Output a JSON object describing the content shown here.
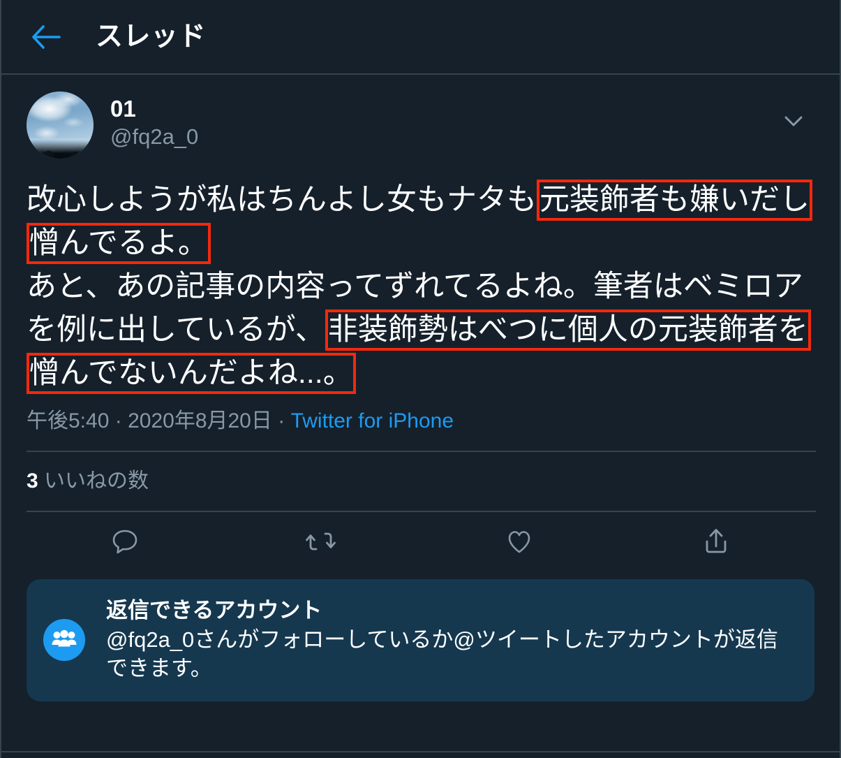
{
  "theme": {
    "background": "#15202b",
    "border": "#38444d",
    "accent": "#1d9bf0",
    "muted_text": "#8899a6",
    "text": "#ffffff",
    "highlight_box": "#f4290c",
    "notice_background": "#15384f"
  },
  "header": {
    "back_icon": "arrow-left-icon",
    "title": "スレッド"
  },
  "tweet": {
    "avatar_alt": "sky-with-clouds-avatar",
    "display_name": "01",
    "handle": "@fq2a_0",
    "more_icon": "chevron-down-icon",
    "text_segments": [
      {
        "text": "改心しようが私はちんよし女もナタも",
        "highlight": false
      },
      {
        "text": "元装飾者も嫌いだし憎んでるよ。",
        "highlight": true
      },
      {
        "text": "\nあと、あの記事の内容ってずれてるよね。筆者はベミロアを例に出しているが、",
        "highlight": false
      },
      {
        "text": "非装飾勢はべつに個人の元装飾者を憎んでないんだよね...。",
        "highlight": true
      }
    ],
    "full_text": "改心しようが私はちんよし女もナタも元装飾者も嫌いだし憎んでるよ。\nあと、あの記事の内容ってずれてるよね。筆者はベミロアを例に出しているが、非装飾勢はべつに個人の元装飾者を憎んでないんだよね...。",
    "meta": {
      "time": "午後5:40",
      "separator_1": "·",
      "date": "2020年8月20日",
      "separator_2": "·",
      "source": "Twitter for iPhone"
    },
    "likes": {
      "count": "3",
      "label": "いいねの数"
    },
    "actions": [
      {
        "name": "reply-icon",
        "label": "返信"
      },
      {
        "name": "retweet-icon",
        "label": "リツイート"
      },
      {
        "name": "like-icon",
        "label": "いいね"
      },
      {
        "name": "share-icon",
        "label": "共有"
      }
    ]
  },
  "reply_notice": {
    "icon": "people-group-icon",
    "title": "返信できるアカウント",
    "body": "@fq2a_0さんがフォローしているか@ツイートしたアカウントが返信できます。"
  }
}
